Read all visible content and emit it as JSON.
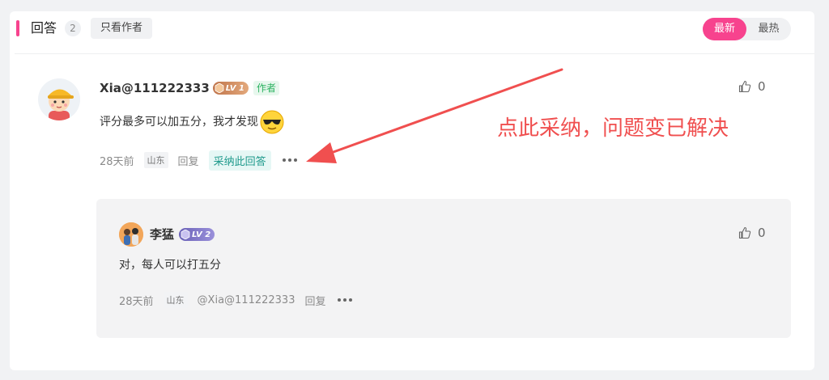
{
  "header": {
    "title": "回答",
    "count": "2",
    "filter_label": "只看作者",
    "sort_options": [
      "最新",
      "最热"
    ],
    "sort_active": "最新"
  },
  "answer": {
    "username": "Xia@111222333",
    "level": "LV 1",
    "author_tag": "作者",
    "content": "评分最多可以加五分，我才发现",
    "time": "28天前",
    "location": "山东",
    "reply_label": "回复",
    "adopt_label": "采纳此回答",
    "likes": "0"
  },
  "annotation": {
    "text": "点此采纳，问题变已解决",
    "color": "#f04f4f"
  },
  "reply": {
    "username": "李猛",
    "level": "LV 2",
    "content": "对，每人可以打五分",
    "time": "28天前",
    "location": "山东",
    "mention": "@Xia@111222333",
    "reply_label": "回复",
    "likes": "0"
  },
  "colors": {
    "accent": "#f7438e",
    "adopt": "#1f9a8c",
    "author": "#2bb260"
  },
  "icons": {
    "like": "thumbs-up-icon",
    "more": "more-dots-icon",
    "emoji": "cool-sunglasses-emoji-icon"
  }
}
